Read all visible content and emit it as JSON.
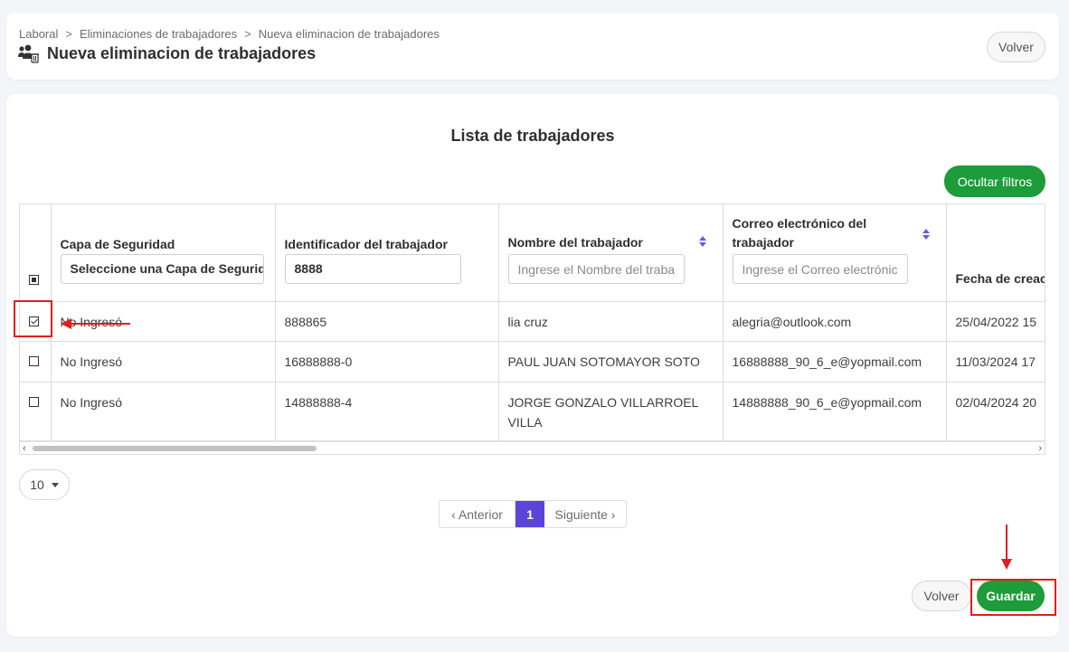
{
  "breadcrumb": [
    "Laboral",
    "Eliminaciones de trabajadores",
    "Nueva eliminacion de trabajadores"
  ],
  "breadcrumb_separator": ">",
  "page_title": "Nueva eliminacion de trabajadores",
  "header_back_button": "Volver",
  "section_title": "Lista de trabajadores",
  "toggle_filters_button": "Ocultar filtros",
  "columns": {
    "capa": "Capa de Seguridad",
    "identificador": "Identificador del trabajador",
    "nombre": "Nombre del trabajador",
    "correo": "Correo electrónico del trabajador",
    "fecha": "Fecha de creac"
  },
  "filters": {
    "capa_value": "Seleccione una Capa de Seguridad",
    "identificador_value": "8888",
    "nombre_placeholder": "Ingrese el Nombre del trabajador",
    "correo_placeholder": "Ingrese el Correo electrónico"
  },
  "rows": [
    {
      "checked": true,
      "capa": "No Ingresó",
      "identificador": "888865",
      "nombre": "lia cruz",
      "correo": "alegria@outlook.com",
      "fecha": "25/04/2022 15"
    },
    {
      "checked": false,
      "capa": "No Ingresó",
      "identificador": "16888888-0",
      "nombre": "PAUL JUAN SOTOMAYOR SOTO",
      "correo": "16888888_90_6_e@yopmail.com",
      "fecha": "11/03/2024 17"
    },
    {
      "checked": false,
      "capa": "No Ingresó",
      "identificador": "14888888-4",
      "nombre": "JORGE GONZALO VILLARROEL VILLA",
      "correo": "14888888_90_6_e@yopmail.com",
      "fecha": "02/04/2024 20"
    }
  ],
  "page_size": "10",
  "pagination": {
    "prev": "‹ Anterior",
    "current": "1",
    "next": "Siguiente ›"
  },
  "footer": {
    "back_button": "Volver",
    "save_button": "Guardar"
  },
  "icons": [
    "users-delete-icon",
    "sort-icon",
    "chevron-down-icon",
    "scroll-left-icon",
    "scroll-right-icon"
  ],
  "colors": {
    "accent_green": "#1e9b3a",
    "pagination_active": "#5a45d6",
    "annotation_red": "#e01f1f"
  }
}
